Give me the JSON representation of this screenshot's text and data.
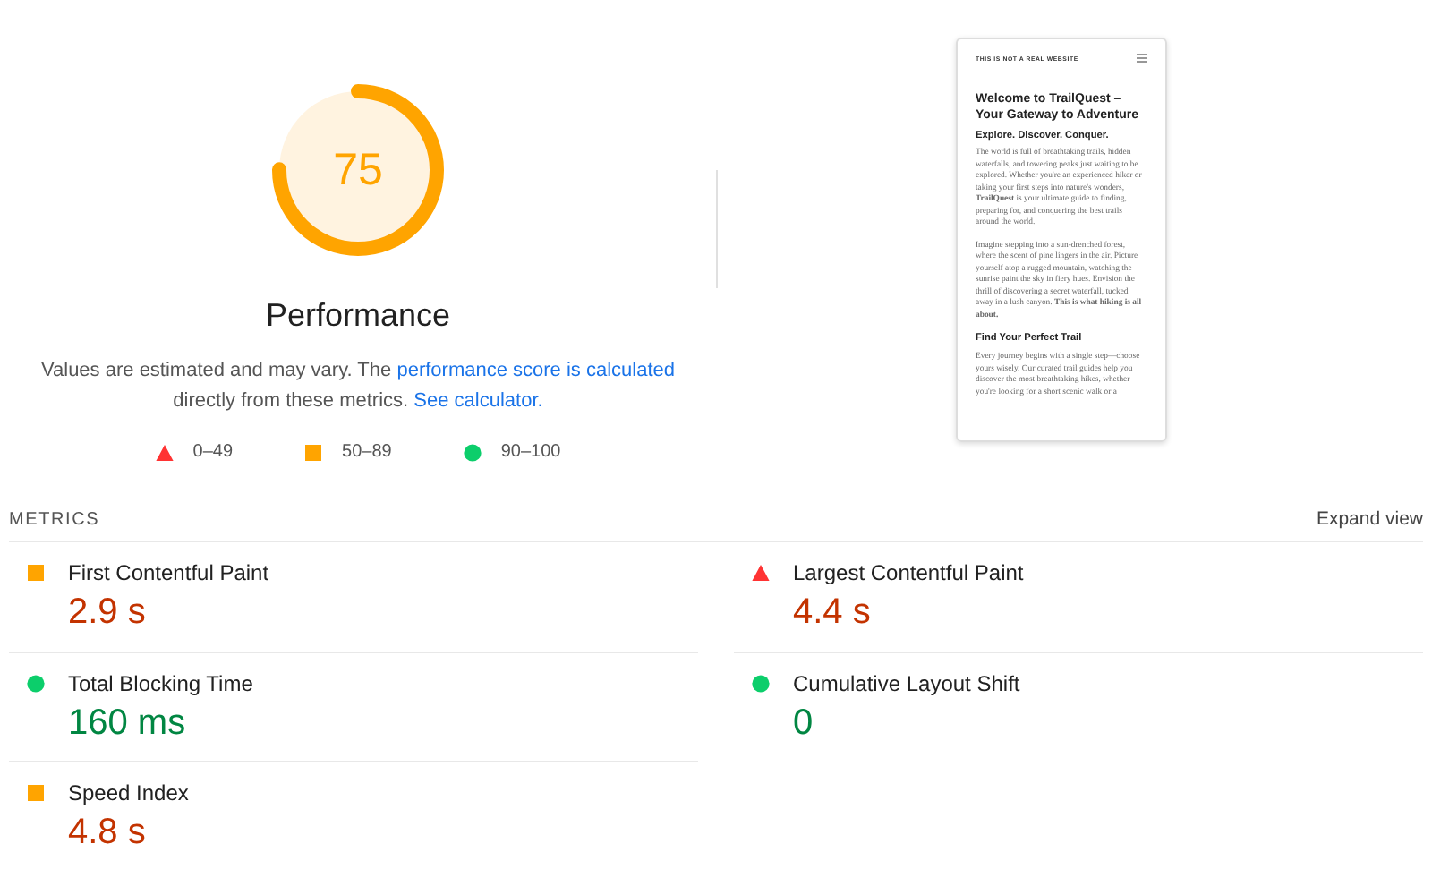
{
  "gauge": {
    "score": "75",
    "kind": "average",
    "title": "Performance"
  },
  "description": [
    {
      "kind": "text",
      "text": "Values are estimated and may vary. The "
    },
    {
      "kind": "link",
      "text": "performance score is calculated"
    },
    {
      "kind": "text",
      "text": " directly from these metrics. "
    },
    {
      "kind": "link",
      "text": "See calculator."
    }
  ],
  "legend": [
    {
      "kind": "fail",
      "label": "0–49"
    },
    {
      "kind": "average",
      "label": "50–89"
    },
    {
      "kind": "pass",
      "label": "90–100"
    }
  ],
  "screenshot": {
    "site_name": "THIS IS NOT A REAL WEBSITE",
    "blocks": [
      {
        "kind": "h1",
        "text": "Welcome to TrailQuest – Your Gateway to Adventure"
      },
      {
        "kind": "h2",
        "text": "Explore. Discover. Conquer."
      },
      {
        "kind": "p",
        "text": "The world is full of breathtaking trails, hidden waterfalls, and towering peaks just waiting to be explored. Whether you're an experienced hiker or taking your first steps into nature's wonders, **TrailQuest** is your ultimate guide to finding, preparing for, and conquering the best trails around the world."
      },
      {
        "kind": "p",
        "text": "Imagine stepping into a sun-drenched forest, where the scent of pine lingers in the air. Picture yourself atop a rugged mountain, watching the sunrise paint the sky in fiery hues. Envision the thrill of discovering a secret waterfall, tucked away in a lush canyon. **This is what hiking is all about.**"
      },
      {
        "kind": "h3",
        "text": "Find Your Perfect Trail"
      },
      {
        "kind": "p",
        "text": "Every journey begins with a single step—choose yours wisely. Our curated trail guides help you discover the most breathtaking hikes, whether you're looking for a short scenic walk or a"
      }
    ]
  },
  "metrics": {
    "title": "METRICS",
    "toggle": "Expand view",
    "items": [
      {
        "name": "First Contentful Paint",
        "value": "2.9 s",
        "kind": "average"
      },
      {
        "name": "Largest Contentful Paint",
        "value": "4.4 s",
        "kind": "fail"
      },
      {
        "name": "Total Blocking Time",
        "value": "160 ms",
        "kind": "pass"
      },
      {
        "name": "Cumulative Layout Shift",
        "value": "0",
        "kind": "pass"
      },
      {
        "name": "Speed Index",
        "value": "4.8 s",
        "kind": "average"
      }
    ]
  }
}
